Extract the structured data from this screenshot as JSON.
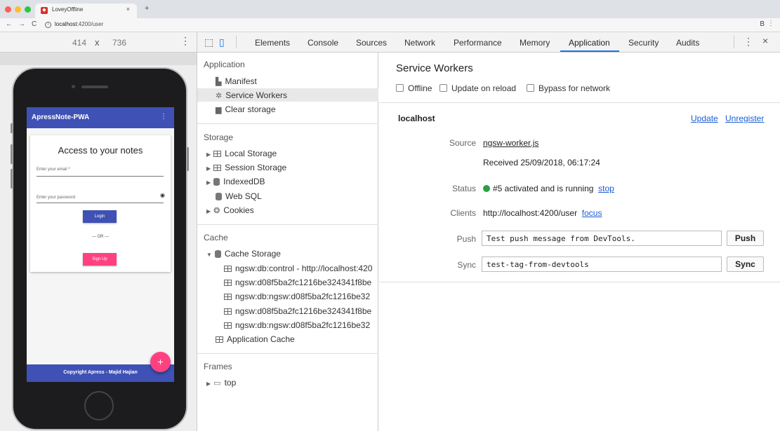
{
  "browser": {
    "tab_title": "LoveyOffline",
    "tab_close": "×",
    "new_tab": "+",
    "url_host": "localhost",
    "url_rest": ":4200/user",
    "back": "←",
    "forward": "→",
    "reload": "C",
    "info_icon": "i",
    "extension_icon": "B",
    "menu": "⋮",
    "traffic_colors": [
      "#ff5f57",
      "#febc2e",
      "#28c840"
    ]
  },
  "device_toolbar": {
    "width": "414",
    "sep": "x",
    "height": "736",
    "more": "⋮"
  },
  "app": {
    "header_title": "ApressNote-PWA",
    "header_menu": "⋮",
    "card_title": "Access to your notes",
    "email_placeholder": "Enter your email *",
    "password_placeholder": "Enter your password",
    "eye_icon": "👁",
    "login_label": "Login",
    "or_label": "— OR —",
    "signup_label": "Sign Up",
    "fab_label": "+",
    "footer": "Copyright Apress - Majid Hajian",
    "primary_color": "#3f51b5",
    "accent_color": "#ff4081"
  },
  "devtools": {
    "tabs": [
      "Elements",
      "Console",
      "Sources",
      "Network",
      "Performance",
      "Memory",
      "Application",
      "Security",
      "Audits"
    ],
    "active_tab": "Application",
    "kebab": "⋮",
    "close": "×",
    "sidebar": {
      "application_head": "Application",
      "manifest": "Manifest",
      "service_workers": "Service Workers",
      "clear_storage": "Clear storage",
      "storage_head": "Storage",
      "local_storage": "Local Storage",
      "session_storage": "Session Storage",
      "indexeddb": "IndexedDB",
      "web_sql": "Web SQL",
      "cookies": "Cookies",
      "cache_head": "Cache",
      "cache_storage": "Cache Storage",
      "cache_entries": [
        "ngsw:db:control - http://localhost:420",
        "ngsw:d08f5ba2fc1216be324341f8be",
        "ngsw:db:ngsw:d08f5ba2fc1216be32",
        "ngsw:d08f5ba2fc1216be324341f8be",
        "ngsw:db:ngsw:d08f5ba2fc1216be32"
      ],
      "application_cache": "Application Cache",
      "frames_head": "Frames",
      "top_frame": "top"
    },
    "service_workers": {
      "title": "Service Workers",
      "offline": "Offline",
      "update_on_reload": "Update on reload",
      "bypass": "Bypass for network",
      "origin": "localhost",
      "update_link": "Update",
      "unregister_link": "Unregister",
      "source_label": "Source",
      "source_file": "ngsw-worker.js",
      "received": "Received 25/09/2018, 06:17:24",
      "status_label": "Status",
      "status_text": "#5 activated and is running",
      "stop_link": "stop",
      "clients_label": "Clients",
      "clients_url": "http://localhost:4200/user",
      "focus_link": "focus",
      "push_label": "Push",
      "push_value": "Test push message from DevTools.",
      "push_button": "Push",
      "sync_label": "Sync",
      "sync_value": "test-tag-from-devtools",
      "sync_button": "Sync",
      "status_color": "#2f9e44"
    }
  }
}
